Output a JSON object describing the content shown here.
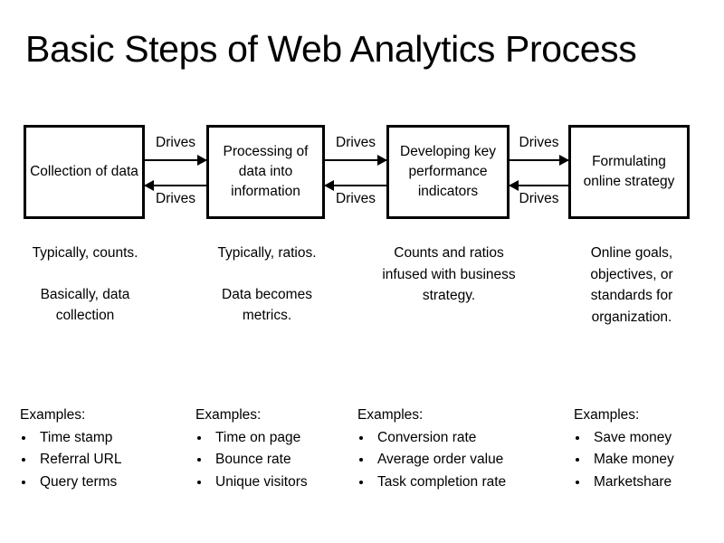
{
  "slide": {
    "title": "Basic Steps of Web Analytics Process",
    "background_color": "#ffffff",
    "text_color": "#000000",
    "border_color": "#000000"
  },
  "flow": {
    "boxes": [
      {
        "label": "Collection of data"
      },
      {
        "label": "Processing of data into information"
      },
      {
        "label": "Developing key performance indicators"
      },
      {
        "label": "Formulating online strategy"
      }
    ],
    "connectors": [
      {
        "forward_label": "Drives",
        "backward_label": "Drives"
      },
      {
        "forward_label": "Drives",
        "backward_label": "Drives"
      },
      {
        "forward_label": "Drives",
        "backward_label": "Drives"
      }
    ]
  },
  "descriptions": [
    {
      "part_a": "Typically, counts.",
      "part_b": "Basically, data collection"
    },
    {
      "part_a": "Typically, ratios.",
      "part_b": "Data becomes metrics."
    },
    {
      "part_a": "Counts and ratios infused with business strategy.",
      "part_b": ""
    },
    {
      "part_a": "Online goals, objectives, or standards for organization.",
      "part_b": ""
    }
  ],
  "examples": [
    {
      "heading": "Examples:",
      "items": [
        "Time stamp",
        "Referral URL",
        "Query terms"
      ]
    },
    {
      "heading": "Examples:",
      "items": [
        "Time on page",
        "Bounce rate",
        "Unique visitors"
      ]
    },
    {
      "heading": "Examples:",
      "items": [
        "Conversion rate",
        "Average order value",
        "Task completion rate"
      ]
    },
    {
      "heading": "Examples:",
      "items": [
        "Save money",
        "Make money",
        "Marketshare"
      ]
    }
  ]
}
